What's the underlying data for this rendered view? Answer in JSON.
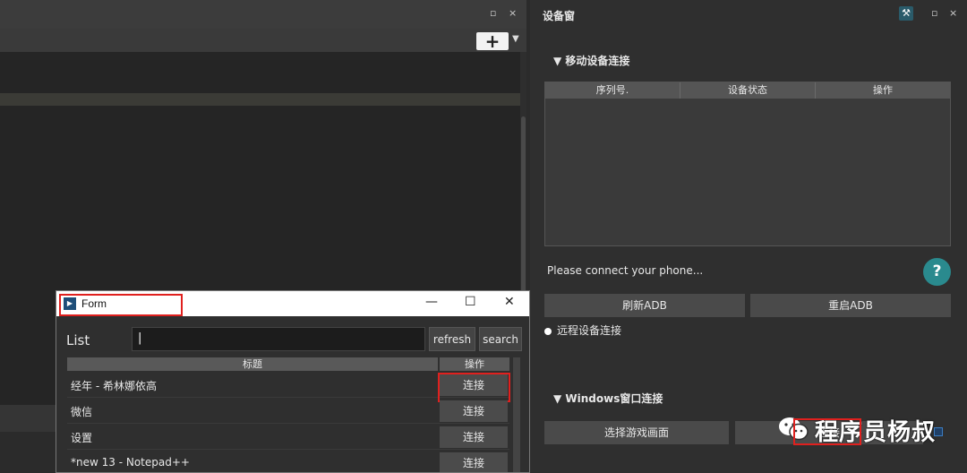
{
  "left_panel": {
    "float_icon": "▫",
    "close_icon": "×",
    "add_label": "+",
    "dropdown_icon": "▼"
  },
  "device_panel": {
    "title": "设备窗",
    "tool_icon": "⚒",
    "float_icon": "▫",
    "close_icon": "×",
    "mobile_section": {
      "label": "▼ 移动设备连接",
      "columns": [
        "序列号.",
        "设备状态",
        "操作"
      ]
    },
    "connect_message": "Please connect your phone...",
    "help_label": "?",
    "refresh_adb_label": "刷新ADB",
    "restart_adb_label": "重启ADB",
    "remote_label": "远程设备连接",
    "windows_section": {
      "label": "▼ Windows窗口连接"
    },
    "select_game_label": "选择游戏画面",
    "second_button_label": "连接"
  },
  "watermark": {
    "text": "程序员杨叔"
  },
  "form_window": {
    "title": "Form",
    "minimize_icon": "—",
    "maximize_icon": "☐",
    "close_icon": "✕",
    "list_label": "List",
    "search_value": "|",
    "refresh_label": "refresh",
    "search_label": "search",
    "columns": [
      "标题",
      "操作"
    ],
    "rows": [
      {
        "title": "经年 - 希林娜依高",
        "action": "连接"
      },
      {
        "title": "微信",
        "action": "连接"
      },
      {
        "title": "设置",
        "action": "连接"
      },
      {
        "title": "*new 13 - Notepad++",
        "action": "连接"
      }
    ]
  }
}
